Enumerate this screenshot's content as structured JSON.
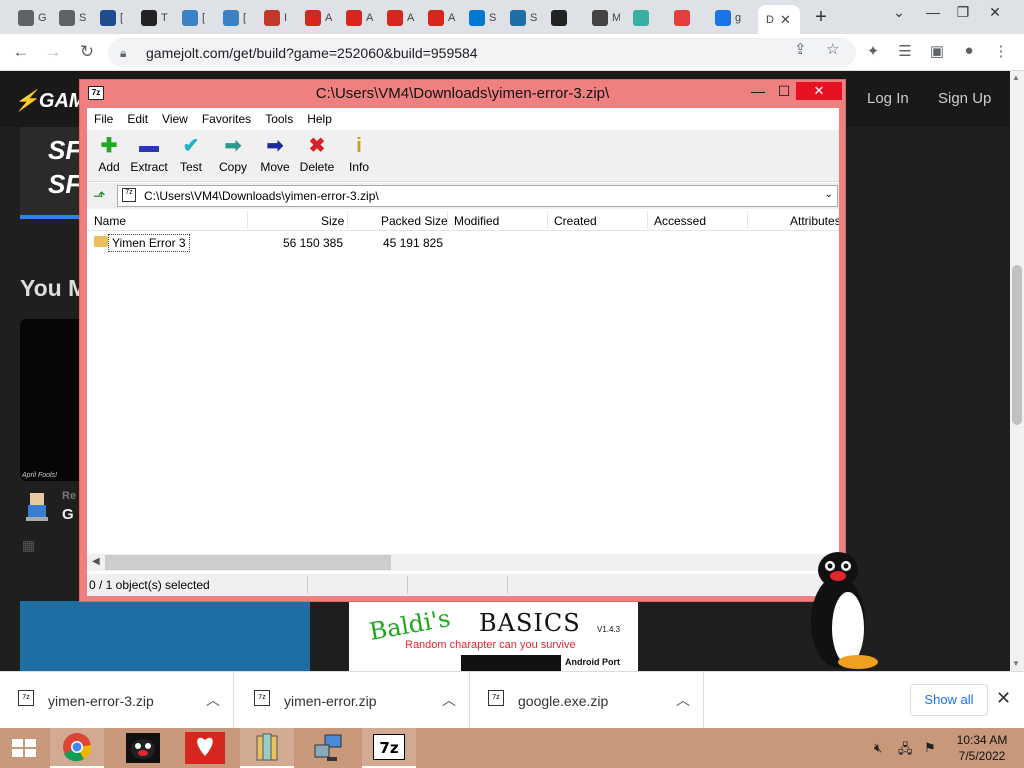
{
  "browser": {
    "tabs": [
      {
        "icon": "generic-globe-icon",
        "title": "G",
        "color": "#5f6368"
      },
      {
        "icon": "generic-globe-icon",
        "title": "S",
        "color": "#5f6368"
      },
      {
        "icon": "square-o-icon",
        "title": "[",
        "color": "#1f4e8c"
      },
      {
        "icon": "building-icon",
        "title": "T",
        "color": "#222"
      },
      {
        "icon": "swirl-icon",
        "title": "[",
        "color": "#3b82c4"
      },
      {
        "icon": "swirl-icon",
        "title": "[",
        "color": "#3b82c4"
      },
      {
        "icon": "hill-icon",
        "title": "I",
        "color": "#c0392b"
      },
      {
        "icon": "adobe-icon",
        "title": "A",
        "color": "#d7261e"
      },
      {
        "icon": "adobe-icon",
        "title": "A",
        "color": "#d7261e"
      },
      {
        "icon": "adobe-icon",
        "title": "A",
        "color": "#d7261e"
      },
      {
        "icon": "adobe-icon",
        "title": "A",
        "color": "#d7261e"
      },
      {
        "icon": "windows-icon",
        "title": "S",
        "color": "#0078d4"
      },
      {
        "icon": "js-icon",
        "title": "S",
        "color": "#1d6fa5"
      },
      {
        "icon": "gamejolt-icon",
        "title": "",
        "color": "#222"
      },
      {
        "icon": "mute-icon",
        "title": "M",
        "color": "#444"
      },
      {
        "icon": "drop-icon",
        "title": "",
        "color": "#36b0a0"
      },
      {
        "icon": "record-icon",
        "title": "",
        "color": "#e63d3d"
      },
      {
        "icon": "search-icon",
        "title": "g",
        "color": "#1a73e8"
      }
    ],
    "active_tab": {
      "title": "D",
      "close": "✕"
    },
    "new_tab": "+",
    "window_controls": {
      "chevron": "⌄",
      "minimize": "—",
      "maximize": "❐",
      "close": "✕"
    },
    "url": "gamejolt.com/get/build?game=252060&build=959584"
  },
  "gamejolt": {
    "logo": "GAM",
    "login": "Log In",
    "signup": "Sign Up",
    "banner_text": [
      "SF",
      "SF"
    ],
    "you_heading": "You M",
    "thumb_caption": "April Fools!",
    "re_text": "Re",
    "g_text": "G",
    "baldi": {
      "title1": "Baldi's",
      "title2": "BASICS",
      "version": "V1.4.3",
      "tagline": "Random charapter can you survive",
      "port": "Android Port"
    }
  },
  "sevenzip": {
    "app_icon": "7z",
    "title": "C:\\Users\\VM4\\Downloads\\yimen-error-3.zip\\",
    "controls": {
      "minimize": "—",
      "maximize": "☐",
      "close": "✕"
    },
    "menu": [
      "File",
      "Edit",
      "View",
      "Favorites",
      "Tools",
      "Help"
    ],
    "toolbar": [
      {
        "label": "Add",
        "icon": "plus-icon",
        "glyph": "✚",
        "color": "#1faa1f"
      },
      {
        "label": "Extract",
        "icon": "minus-icon",
        "glyph": "▬",
        "color": "#2a33c4"
      },
      {
        "label": "Test",
        "icon": "check-icon",
        "glyph": "✔",
        "color": "#20b0c8"
      },
      {
        "label": "Copy",
        "icon": "copy-arrow-icon",
        "glyph": "➡",
        "color": "#2a9a8a"
      },
      {
        "label": "Move",
        "icon": "move-arrow-icon",
        "glyph": "➡",
        "color": "#1a2a9a"
      },
      {
        "label": "Delete",
        "icon": "delete-x-icon",
        "glyph": "✖",
        "color": "#d8222a"
      },
      {
        "label": "Info",
        "icon": "info-icon",
        "glyph": "i",
        "color": "#c8a010"
      }
    ],
    "path": "C:\\Users\\VM4\\Downloads\\yimen-error-3.zip\\",
    "columns": [
      "Name",
      "Size",
      "Packed Size",
      "Modified",
      "Created",
      "Accessed",
      "Attributes"
    ],
    "rows": [
      {
        "name": "Yimen Error 3",
        "size": "56 150 385",
        "packed": "45 191 825"
      }
    ],
    "status": "0 / 1 object(s) selected"
  },
  "downloads": {
    "items": [
      {
        "name": "yimen-error-3.zip"
      },
      {
        "name": "yimen-error.zip"
      },
      {
        "name": "google.exe.zip"
      }
    ],
    "show_all": "Show all",
    "close": "✕"
  },
  "taskbar": {
    "time": "10:34 AM",
    "date": "7/5/2022",
    "colors": {
      "bg": "#c8987a"
    }
  }
}
